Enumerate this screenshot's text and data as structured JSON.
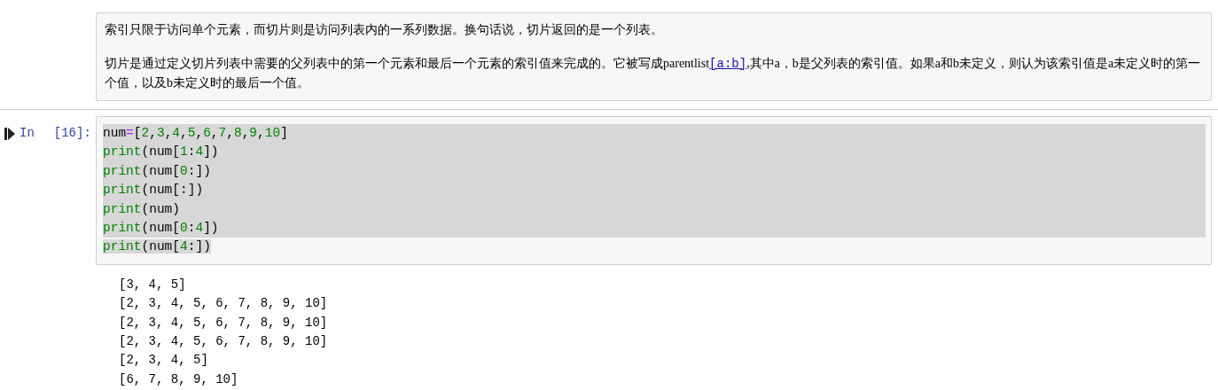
{
  "markdown_cell": {
    "paragraph_1": "索引只限于访问单个元素，而切片则是访问列表内的一系列数据。换句话说，切片返回的是一个列表。",
    "paragraph_2": {
      "before": "切片是通过定义切片列表中需要的父列表中的第一个元素和最后一个元素的索引值来完成的。它被写成parentlist",
      "link": "[a:b]",
      "after": ",其中a，b是父列表的索引值。如果a和b未定义，则认为该索引值是a未定义时的第一个值，以及b未定义时的最后一个值。"
    }
  },
  "code_cell": {
    "prompt_label": "In",
    "execution_count": "[16]:",
    "lines": [
      "num=[2,3,4,5,6,7,8,9,10]",
      "print(num[1:4])",
      "print(num[0:])",
      "print(num[:])",
      "print(num)",
      "print(num[0:4])",
      "print(num[4:])"
    ],
    "output": [
      "[3, 4, 5]",
      "[2, 3, 4, 5, 6, 7, 8, 9, 10]",
      "[2, 3, 4, 5, 6, 7, 8, 9, 10]",
      "[2, 3, 4, 5, 6, 7, 8, 9, 10]",
      "[2, 3, 4, 5]",
      "[6, 7, 8, 9, 10]"
    ]
  }
}
